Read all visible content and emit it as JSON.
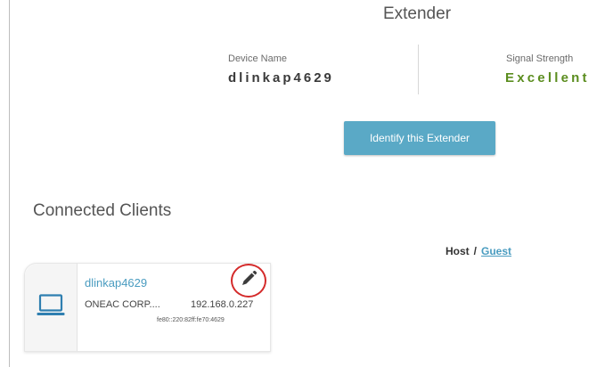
{
  "header": {
    "title": "Extender"
  },
  "device": {
    "name_label": "Device Name",
    "name_value": "dlinkap4629",
    "signal_label": "Signal Strength",
    "signal_value": "Excellent"
  },
  "actions": {
    "identify_label": "Identify this Extender"
  },
  "clients": {
    "heading": "Connected Clients",
    "filter": {
      "host_label": "Host",
      "separator": "/",
      "guest_label": "Guest"
    },
    "items": [
      {
        "name": "dlinkap4629",
        "vendor": "ONEAC CORP....",
        "ipv4": "192.168.0.227",
        "ipv6": "fe80::220:82ff:fe70:4629",
        "icon": "laptop-icon"
      }
    ]
  },
  "colors": {
    "accent": "#5aa9c6",
    "link": "#4a9cc0",
    "signal_good": "#5b8d1f",
    "highlight_circle": "#d42a2a"
  }
}
